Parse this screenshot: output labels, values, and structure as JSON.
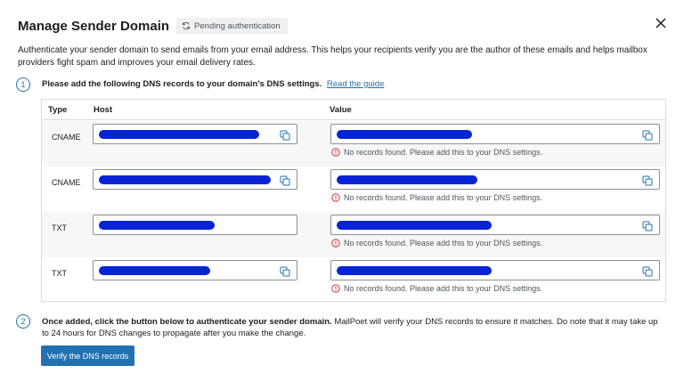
{
  "header": {
    "title": "Manage Sender Domain",
    "badge": "Pending authentication"
  },
  "intro": "Authenticate your sender domain to send emails from your email address. This helps your recipients verify you are the author of these emails and helps mailbox providers fight spam and improves your email delivery rates.",
  "step1": {
    "number": "1",
    "text": "Please add the following DNS records to your domain’s DNS settings.",
    "link": "Read the guide"
  },
  "table": {
    "columns": [
      "Type",
      "Host",
      "Value"
    ],
    "rows": [
      {
        "type": "CNAME",
        "error": "No records found. Please add this to your DNS settings."
      },
      {
        "type": "CNAME",
        "error": "No records found. Please add this to your DNS settings."
      },
      {
        "type": "TXT",
        "error": "No records found. Please add this to your DNS settings."
      },
      {
        "type": "TXT",
        "error": "No records found. Please add this to your DNS settings."
      }
    ]
  },
  "step2": {
    "number": "2",
    "bold_text": "Once added, click the button below to authenticate your sender domain.",
    "text": " MailPoet will verify your DNS records to ensure it matches. Do note that it may take up to 24 hours for DNS changes to propagate after you make the change."
  },
  "verify_button": "Verify the DNS records",
  "icons": {
    "badge": "sync-icon",
    "close": "close-icon",
    "copy": "copy-icon",
    "error": "error-icon"
  },
  "colors": {
    "accent": "#2271b1",
    "error": "#d63638",
    "redaction": "#0624d6"
  }
}
